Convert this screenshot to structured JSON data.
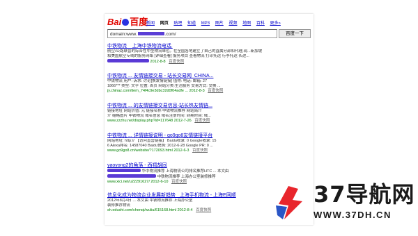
{
  "baidu": {
    "logo_left": "Bai",
    "logo_right": "百度",
    "nav": [
      "新闻",
      "网页",
      "贴吧",
      "知道",
      "MP3",
      "图片",
      "视频",
      "地图",
      "百科",
      "更多»"
    ],
    "nav_active_index": 1,
    "query_prefix": "domain:www.",
    "query_suffix": ".com/",
    "search_button": "百度一下"
  },
  "results": [
    {
      "title": "中铁物流__上海中铁物流电话,",
      "lines": [
        "航空/公路联营的综合性中型物流单位。在全国各地建立了自己的直属分部和代理,现...新加坡",
        "和美国航空专线的服务网络 [详细查看] 服务项目 查看物流 打印托运 行李托运 长途..."
      ],
      "url": "",
      "date": "2012-8-8",
      "snapshot": "百度快照"
    },
    {
      "title": "中铁物流 ... 友情链接交易 - 站长交易网_CHINA...",
      "lines": [
        "中铁物流 用户: 诉求: 讨论[换友情链接] 值得: 电话: 邮箱: 27",
        "1866*** 类型: 文字 位置: 首页 网站分类:生活服务 交易方式: 交换 ..."
      ],
      "url": "jy.chinaz.com/item_74f4c9e3dbc32d0f04adfe ...",
      "date": "2012-8-3",
      "snapshot": "百度快照"
    },
    {
      "title": "中铁物流 ... 的友情链接交易信息-站长热友情链...",
      "lines": [
        "链接地址 网站价值: 元 链接名称 中铁物流推荐 网站简介",
        "介 缩略图片 中铁物流 域名信息 域名注册时间: 到期时间: 域..."
      ],
      "url": "www.zzzhu.net/display.php?id=117648",
      "date": "2012-7-26",
      "snapshot": "百度快照"
    },
    {
      "title": "中铁物流 ... 详情链接说明 - go9go8友情链接平台",
      "lines": [
        "网站地址: http:// 【访问直营链接】 Baidu收录: 0 Google收录: 15",
        "6 Alexa排名: 14587040 Baidu快照: 2012-6-28 Google PR: 0 ..."
      ],
      "url": "www.go9go8.cn/website/?172093.html",
      "date": "2012-6-3",
      "snapshot": "百度快照"
    },
    {
      "title": "yaoyong2的角落 - 西祠胡同",
      "lines": [
        "华中物流推荐 上海物流公司排名推荐HTC ... 本文由",
        "中铁物流推荐 上海办公室装修推荐"
      ],
      "url": "www.xici.net/u22291627/",
      "date": "2012-6-10",
      "snapshot": "百度快照"
    },
    {
      "title": "信息化成为物流企业发展新趋势 _上海手机物流 - 上海E网顺",
      "lines": [
        "2012年8月4日 ... 本文由 中铁物流推荐 上海办公室",
        "装修推荐物流"
      ],
      "url": "sh.edushi.com/chenqi/wuliu/615168.html",
      "date": "2012-8-4",
      "snapshot": "百度快照"
    }
  ],
  "watermark": {
    "brand": "37导航网",
    "site": "WWW.37DH.CN",
    "colors": {
      "red": "#e8262d",
      "blue": "#2a56c6"
    }
  }
}
